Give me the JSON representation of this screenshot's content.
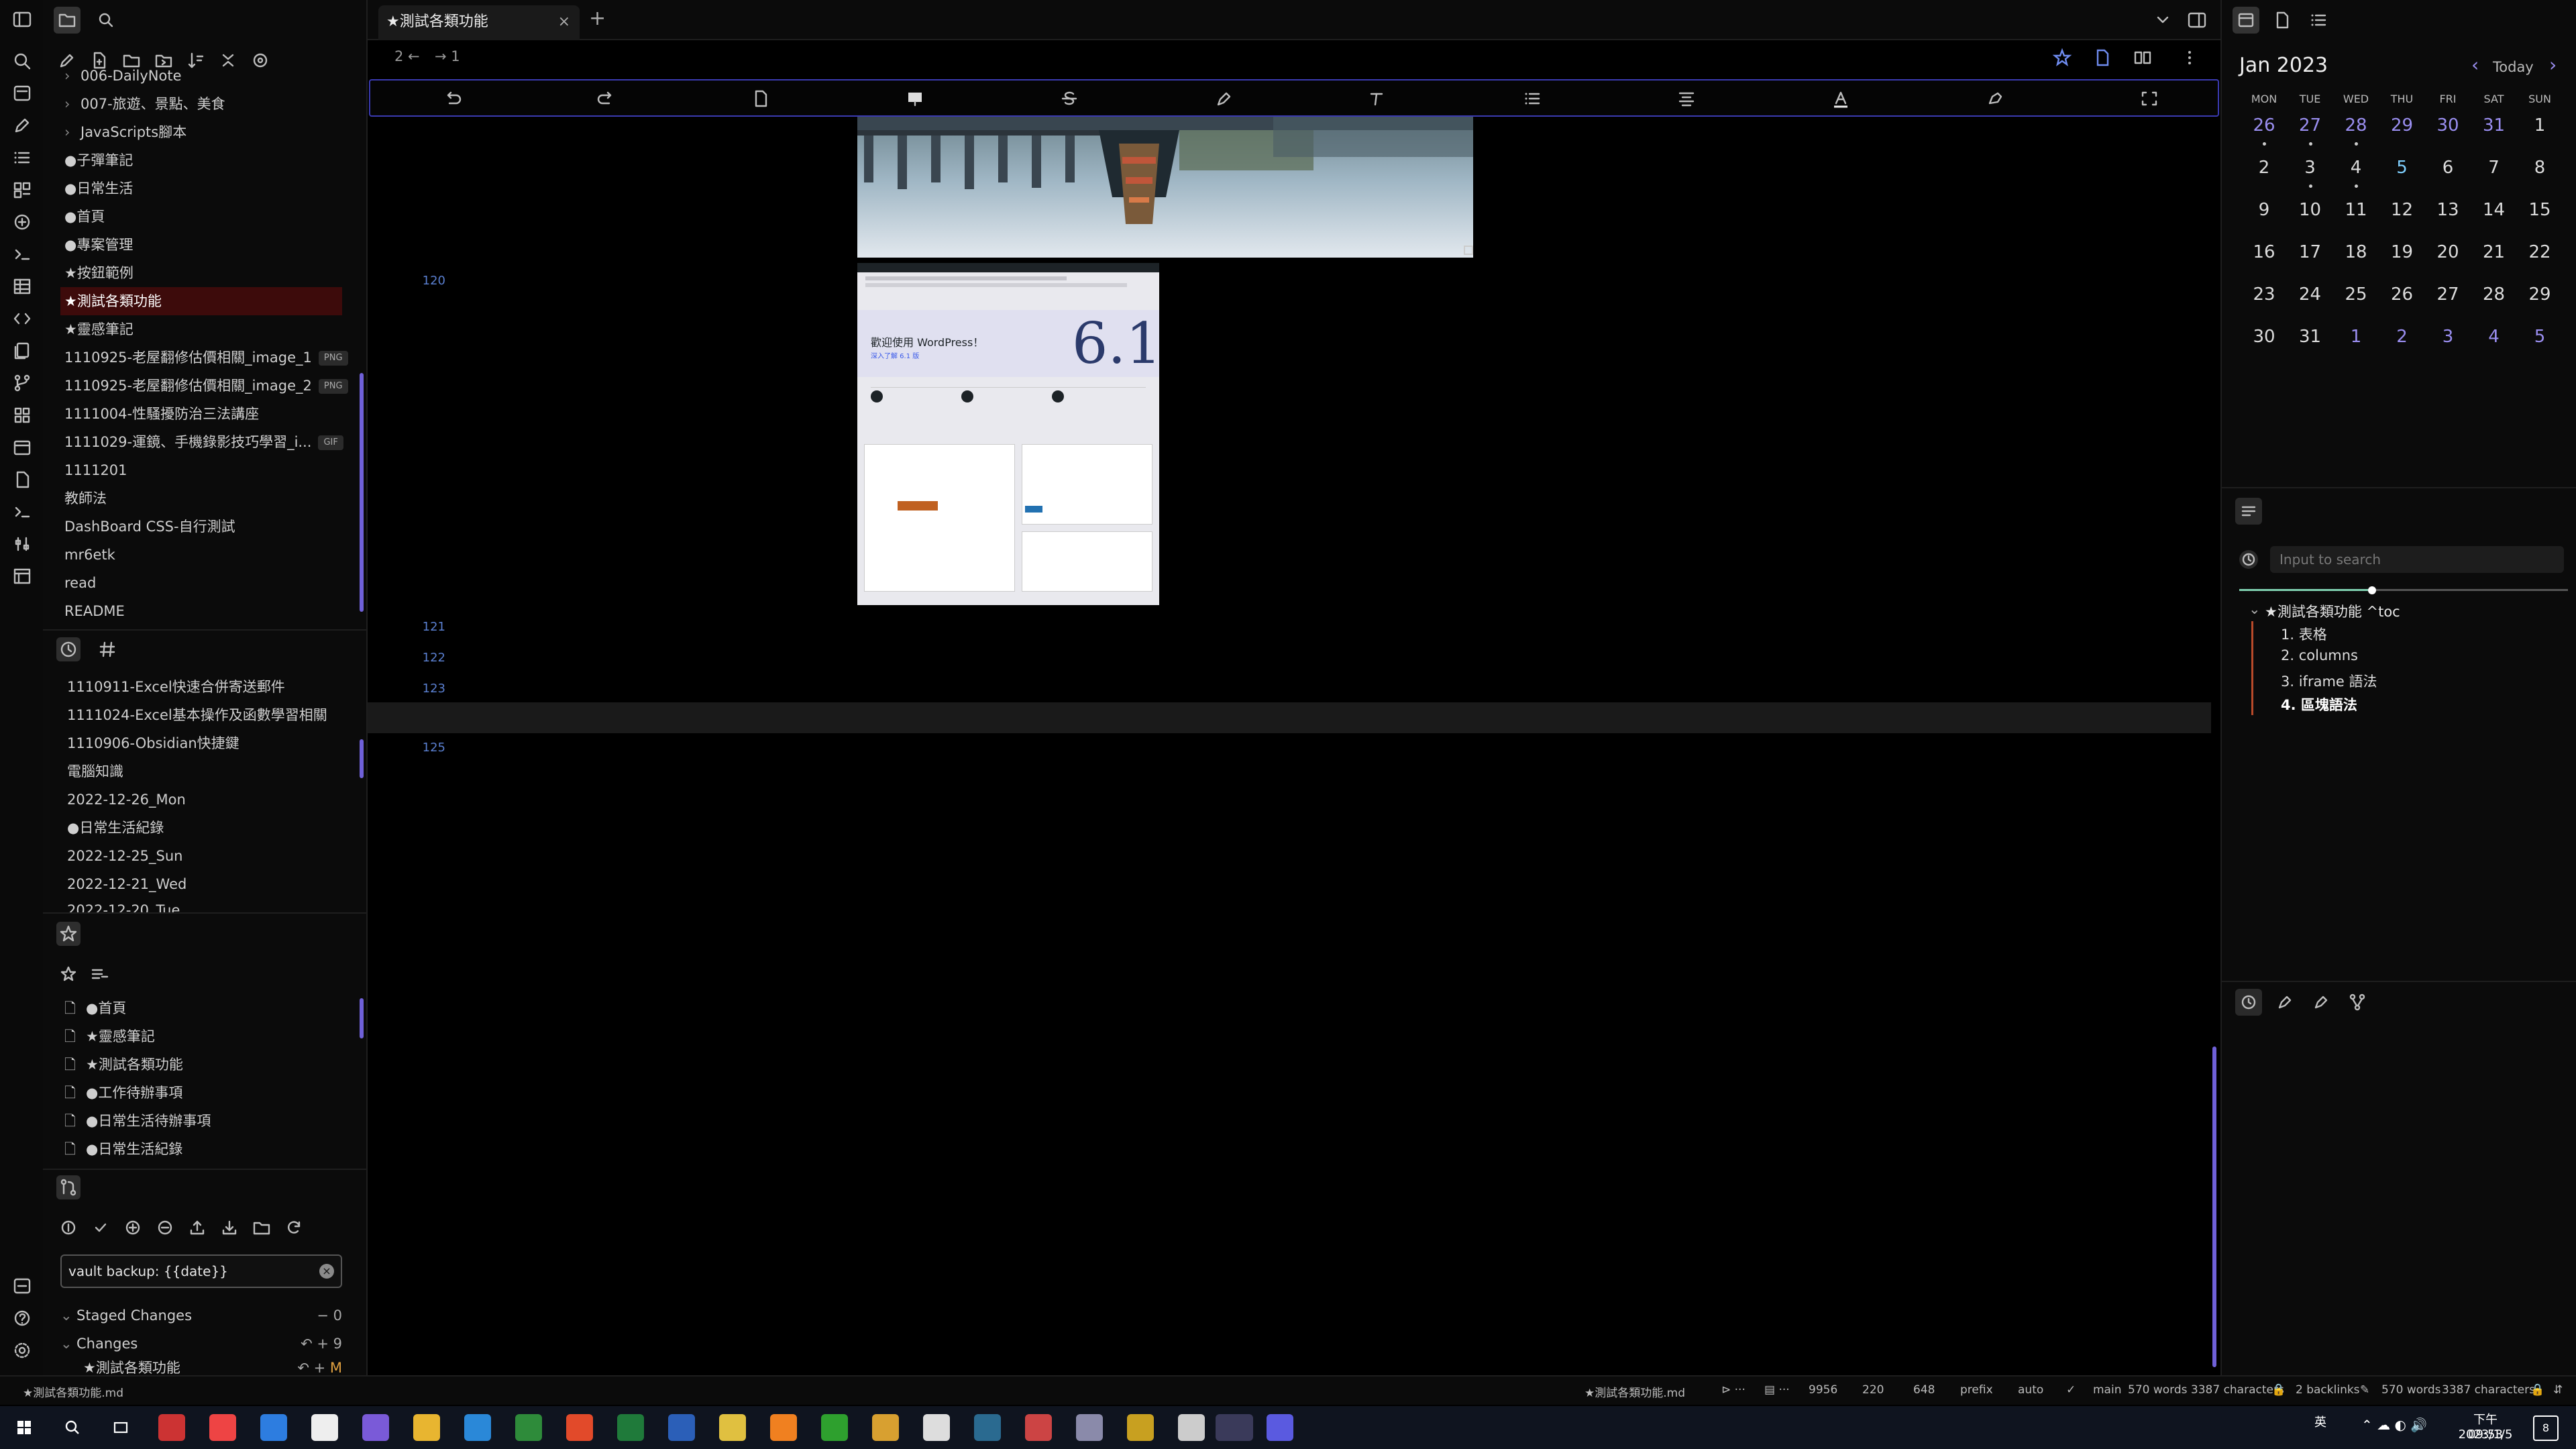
{
  "ribbon": {
    "icons": [
      "sidebar-toggle-icon",
      "search-icon",
      "inbox-icon",
      "edit-icon",
      "list-icon",
      "blocks-icon",
      "add-circle-icon",
      "terminal-icon",
      "table-icon",
      "code-icon",
      "copy-icon",
      "git-branch-icon",
      "grid-icon",
      "calendar-icon",
      "file-icon",
      "terminal2-icon",
      "sliders-icon",
      "kanban-icon",
      "help-icon",
      "settings-icon",
      "vault-icon"
    ]
  },
  "file_explorer": {
    "items": [
      {
        "label": "006-DailyNote",
        "chevron": "›"
      },
      {
        "label": "007-旅遊、景點、美食",
        "chevron": "›"
      },
      {
        "label": "JavaScripts腳本",
        "chevron": "›"
      },
      {
        "label": "●子彈筆記"
      },
      {
        "label": "●日常生活"
      },
      {
        "label": "●首頁"
      },
      {
        "label": "●專案管理"
      },
      {
        "label": "★按鈕範例"
      },
      {
        "label": "★測試各類功能",
        "selected": true
      },
      {
        "label": "★靈感筆記"
      },
      {
        "label": "1110925-老屋翻修估價相關_image_1",
        "tag": "PNG"
      },
      {
        "label": "1110925-老屋翻修估價相關_image_2",
        "tag": "PNG"
      },
      {
        "label": "1111004-性騷擾防治三法講座"
      },
      {
        "label": "1111029-運鏡、手機錄影技巧學習_i...",
        "tag": "GIF"
      },
      {
        "label": "1111201"
      },
      {
        "label": "教師法"
      },
      {
        "label": "DashBoard CSS-自行測試"
      },
      {
        "label": "mr6etk"
      },
      {
        "label": "read"
      },
      {
        "label": "README"
      }
    ]
  },
  "recent": {
    "items": [
      "1110911-Excel快速合併寄送郵件",
      "1111024-Excel基本操作及函數學習相關",
      "1110906-Obsidian快捷鍵",
      "電腦知識",
      "2022-12-26_Mon",
      "●日常生活紀錄",
      "2022-12-25_Sun",
      "2022-12-21_Wed"
    ],
    "cut_item": "2022-12-20_Tue"
  },
  "bookmarks": {
    "items": [
      "●首頁",
      "★靈感筆記",
      "★測試各類功能",
      "●工作待辦事項",
      "●日常生活待辦事項",
      "●日常生活紀錄"
    ]
  },
  "git": {
    "commit_message": "vault backup: {{date}}",
    "staged_label": "Staged Changes",
    "staged_count": "0",
    "changes_label": "Changes",
    "changes_count": "9",
    "change_file": "★測試各類功能",
    "change_flag": "M"
  },
  "editor": {
    "tab_title": "★測試各類功能",
    "tab_close": "×",
    "new_tab": "+",
    "back_count": "2",
    "forward_count": "1",
    "line_numbers": [
      "120",
      "121",
      "122",
      "123",
      "125"
    ],
    "embed_image2": {
      "title": "歡迎使用 WordPress！",
      "subtitle": "深入了解 6.1 版",
      "big": "6.1"
    }
  },
  "calendar": {
    "month": "Jan 2023",
    "today": "Today",
    "prev": "‹",
    "next": "›",
    "weekdays": [
      "MON",
      "TUE",
      "WED",
      "THU",
      "FRI",
      "SAT",
      "SUN"
    ],
    "weeks": [
      [
        "26",
        "27",
        "28",
        "29",
        "30",
        "31",
        "1"
      ],
      [
        "2",
        "3",
        "4",
        "5",
        "6",
        "7",
        "8"
      ],
      [
        "9",
        "10",
        "11",
        "12",
        "13",
        "14",
        "15"
      ],
      [
        "16",
        "17",
        "18",
        "19",
        "20",
        "21",
        "22"
      ],
      [
        "23",
        "24",
        "25",
        "26",
        "27",
        "28",
        "29"
      ],
      [
        "30",
        "31",
        "1",
        "2",
        "3",
        "4",
        "5"
      ]
    ],
    "today_date": "5"
  },
  "outline": {
    "search_placeholder": "Input to search",
    "root": "★測試各類功能 ^toc",
    "items": [
      "1. 表格",
      "2. columns",
      "3. iframe 語法",
      "4. 區塊語法"
    ],
    "active": "4. 區塊語法"
  },
  "status": {
    "file": "★測試各類功能.md",
    "active_file": "★測試各類功能.md",
    "a": "9956",
    "b": "220",
    "c": "648",
    "prefix": "prefix",
    "auto": "auto",
    "branch": "main",
    "words_chars": "570 words 3387 characters",
    "backlinks": "2 backlinks",
    "words": "570 words",
    "chars": "3387 characters"
  },
  "taskbar": {
    "time": "下午 09:53",
    "date": "2023/1/5",
    "ime": "英",
    "notif_count": "8"
  },
  "colors": {
    "accent": "#6f60d8",
    "selection": "#3d0b0b",
    "toolbar_border": "#3a3ab0",
    "outline_bar": "#b84a2a"
  }
}
